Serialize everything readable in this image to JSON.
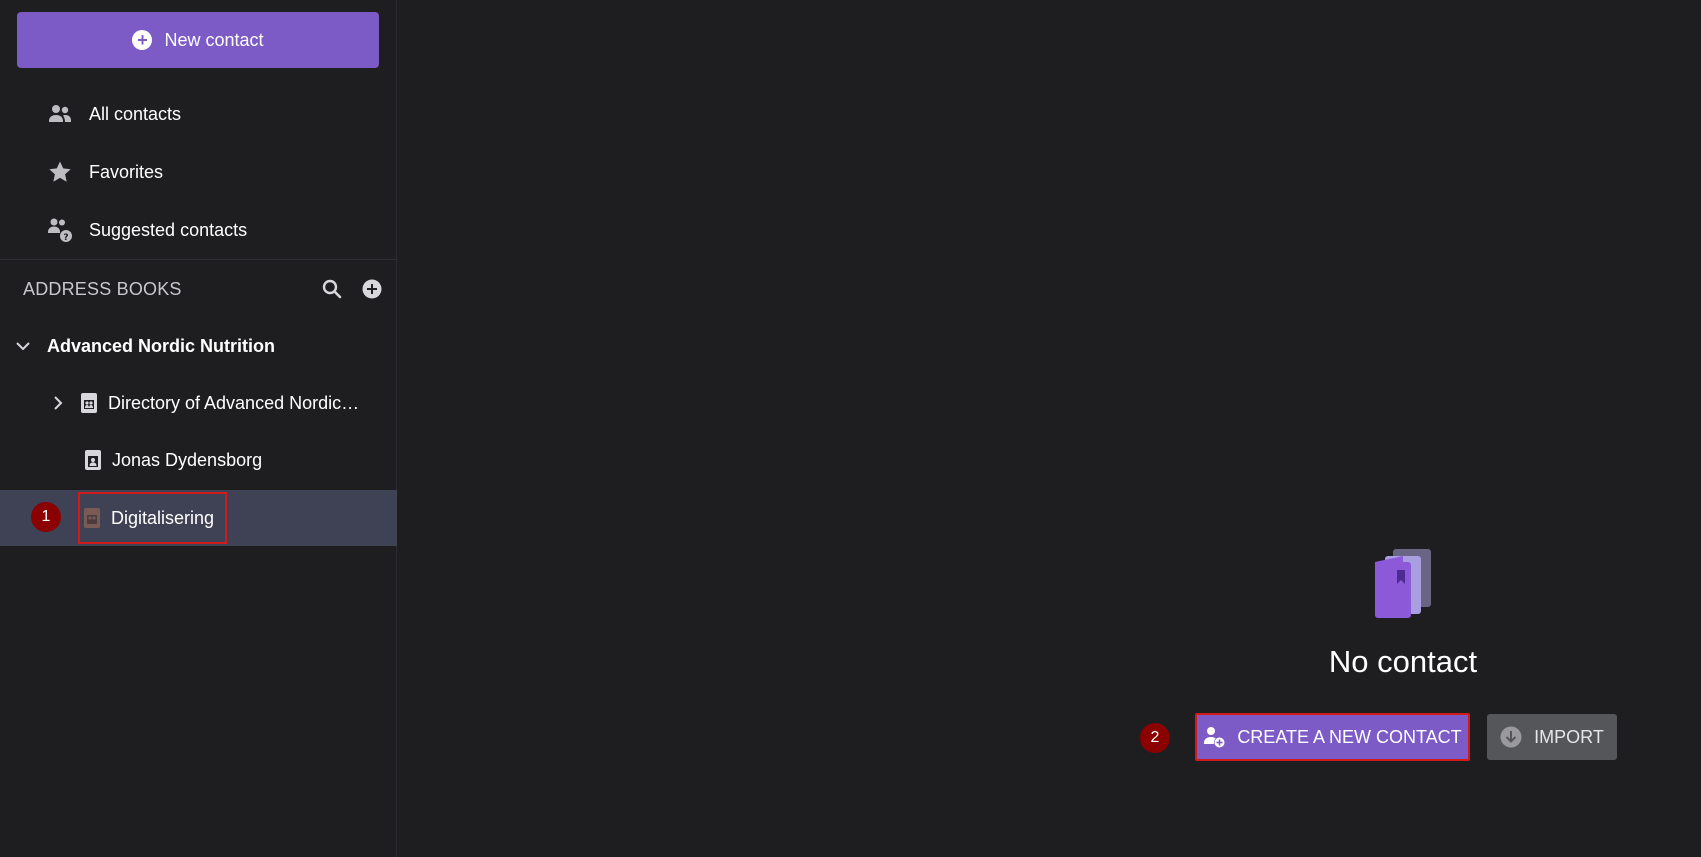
{
  "sidebar": {
    "new_contact_label": "New contact",
    "nav": [
      {
        "label": "All contacts",
        "icon": "people-icon"
      },
      {
        "label": "Favorites",
        "icon": "star-icon"
      },
      {
        "label": "Suggested contacts",
        "icon": "people-question-icon"
      }
    ],
    "address_books_title": "ADDRESS BOOKS",
    "tree": {
      "org_label": "Advanced Nordic Nutrition",
      "directory_label": "Directory of Advanced Nordic…",
      "personal_label": "Jonas Dydensborg",
      "selected_label": "Digitalisering"
    }
  },
  "main": {
    "empty_title": "No contact",
    "create_label": "CREATE A NEW CONTACT",
    "import_label": "IMPORT"
  },
  "annotations": {
    "badge_1": "1",
    "badge_2": "2"
  },
  "colors": {
    "accent": "#7c5bc7",
    "background": "#1e1e21",
    "selected": "#3f4155",
    "highlight": "#d11a1a",
    "badge": "#8b0000"
  }
}
